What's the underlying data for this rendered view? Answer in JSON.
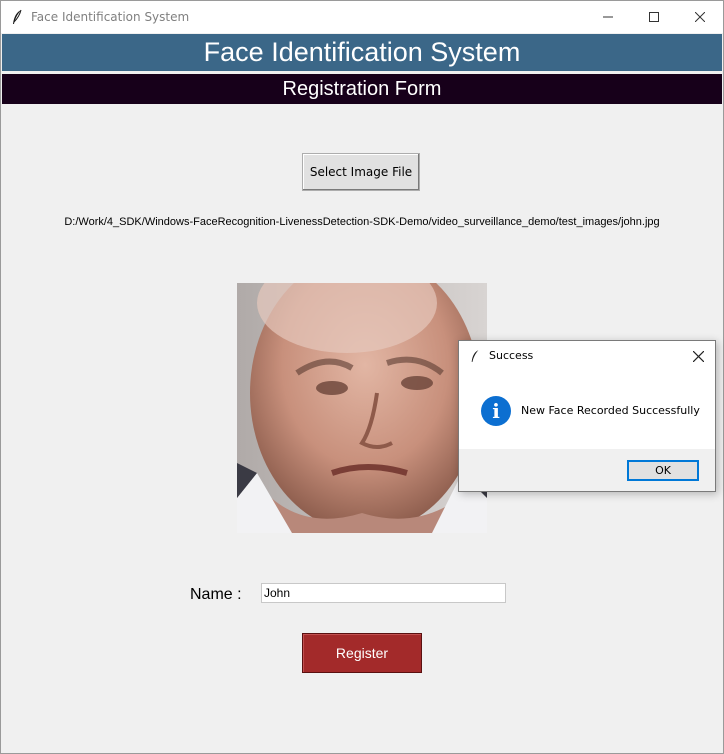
{
  "window": {
    "title": "Face Identification System",
    "icon": "feather-icon"
  },
  "header": {
    "title": "Face Identification System",
    "subtitle": "Registration Form",
    "colors": {
      "title_bg": "#3b6788",
      "subtitle_bg": "#17001a"
    }
  },
  "form": {
    "select_button_label": "Select Image File",
    "file_path": "D:/Work/4_SDK/Windows-FaceRecognition-LivenessDetection-SDK-Demo/video_surveillance_demo/test_images/john.jpg",
    "name_label": "Name :",
    "name_value": "John",
    "register_button_label": "Register",
    "register_color": "#a32a2a"
  },
  "dialog": {
    "title": "Success",
    "message": "New Face Recorded Successfully",
    "ok_label": "OK",
    "icon": "info-icon"
  }
}
